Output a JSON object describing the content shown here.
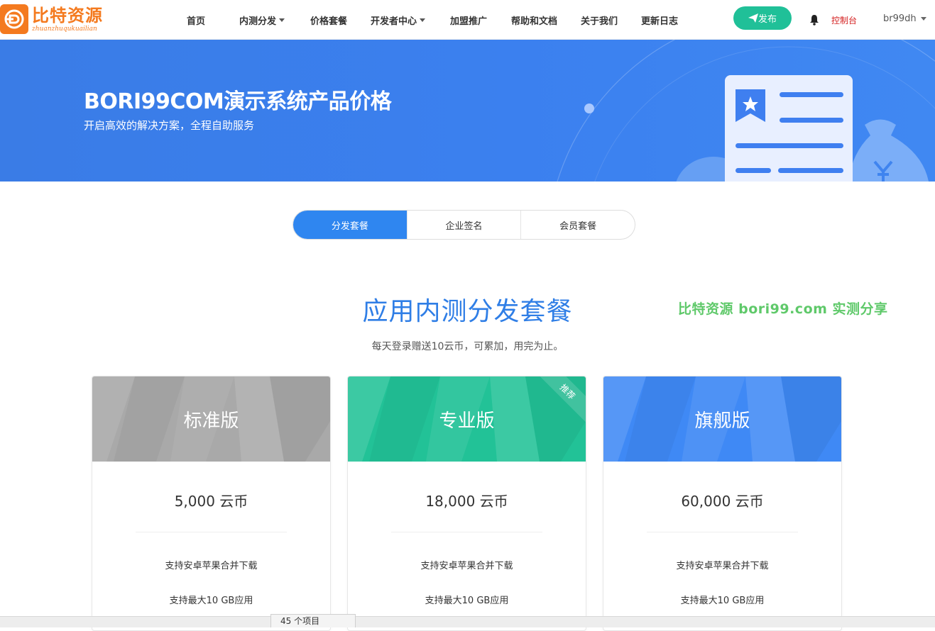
{
  "logo": {
    "title": "比特资源",
    "subtitle": "zhuanzhuqukuailian"
  },
  "nav": {
    "items": [
      {
        "label": "首页",
        "dropdown": false
      },
      {
        "label": "内测分发",
        "dropdown": true
      },
      {
        "label": "价格套餐",
        "dropdown": false
      },
      {
        "label": "开发者中心",
        "dropdown": true
      },
      {
        "label": "加盟推广",
        "dropdown": false
      },
      {
        "label": "帮助和文档",
        "dropdown": false
      },
      {
        "label": "关于我们",
        "dropdown": false
      },
      {
        "label": "更新日志",
        "dropdown": false
      }
    ],
    "publish_label": "发布",
    "console_label": "控制台",
    "username": "br99dh"
  },
  "banner": {
    "title": "BORI99COM演示系统产品价格",
    "subtitle": "开启高效的解决方案，全程自助服务"
  },
  "tabs": [
    {
      "label": "分发套餐",
      "active": true
    },
    {
      "label": "企业签名",
      "active": false
    },
    {
      "label": "会员套餐",
      "active": false
    }
  ],
  "section": {
    "title": "应用内测分发套餐",
    "subtitle": "每天登录赠送10云币，可累加，用完为止。",
    "watermark": "比特资源 bori99.com 实测分享"
  },
  "plans": [
    {
      "name": "标准版",
      "price": "5,000 云币",
      "features": [
        "支持安卓苹果合并下载",
        "支持最大10 GB应用"
      ],
      "color": "#a9a9a9",
      "badge": ""
    },
    {
      "name": "专业版",
      "price": "18,000 云币",
      "features": [
        "支持安卓苹果合并下载",
        "支持最大10 GB应用"
      ],
      "color": "#22c297",
      "badge": "推荐"
    },
    {
      "name": "旗舰版",
      "price": "60,000 云币",
      "features": [
        "支持安卓苹果合并下载",
        "支持最大10 GB应用"
      ],
      "color": "#3f89f5",
      "badge": ""
    }
  ],
  "status_bar": {
    "items_label": "45 个项目"
  },
  "colors": {
    "accent": "#2f86f0",
    "publish": "#20c098",
    "brand": "#f47a1f",
    "console": "#d42020"
  }
}
